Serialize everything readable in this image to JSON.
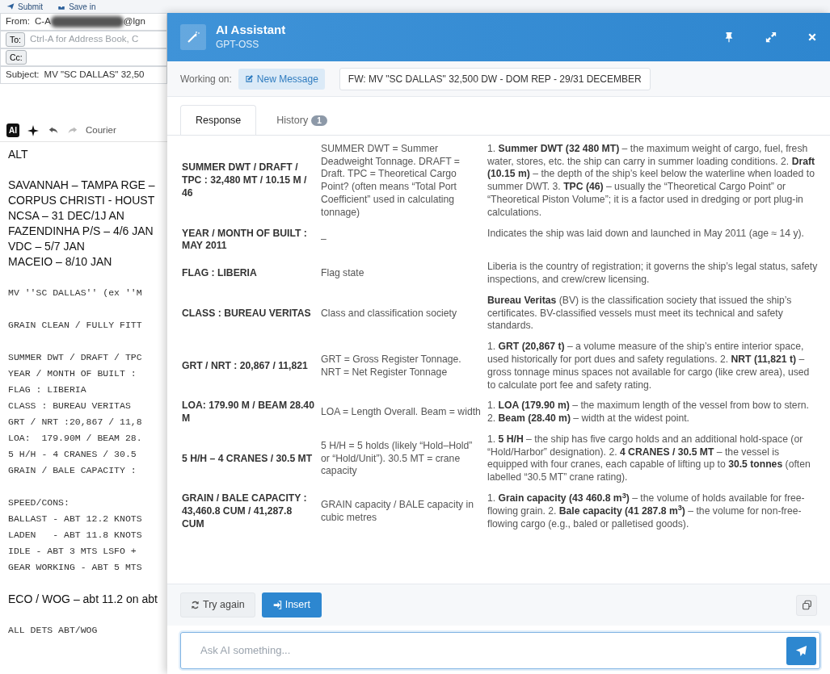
{
  "email": {
    "toolbar": [
      "Submit",
      "Save in"
    ],
    "from_label": "From:",
    "from_start": "C-A",
    "from_end": "@lgn",
    "to_label": "To:",
    "to_placeholder": "Ctrl-A for Address Book, C",
    "cc_label": "Cc:",
    "subject_label": "Subject:",
    "subject_value": "MV \"SC DALLAS\" 32,50",
    "editor_toolbar": {
      "ai_badge": "AI",
      "font": "Courier"
    },
    "body_blocks": [
      {
        "kind": "sans",
        "lines": [
          "ALT"
        ]
      },
      {
        "kind": "sans",
        "lines": [
          "SAVANNAH – TAMPA RGE –",
          "CORPUS CHRISTI - HOUST",
          "NCSA – 31 DEC/1J AN",
          "FAZENDINHA P/S – 4/6 JAN",
          "VDC – 5/7 JAN",
          "MACEIO – 8/10 JAN"
        ]
      },
      {
        "kind": "mono",
        "lines": [
          "MV ''SC DALLAS'' (ex ''M"
        ]
      },
      {
        "kind": "mono",
        "lines": [
          "GRAIN CLEAN / FULLY FITT"
        ]
      },
      {
        "kind": "mono",
        "lines": [
          "SUMMER DWT / DRAFT / TPC",
          "YEAR / MONTH OF BUILT :",
          "FLAG : LIBERIA",
          "CLASS : BUREAU VERITAS",
          "GRT / NRT :20,867 / 11,8",
          "LOA:  179.90M / BEAM 28.",
          "5 H/H - 4 CRANES / 30.5",
          "GRAIN / BALE CAPACITY :"
        ]
      },
      {
        "kind": "mono",
        "lines": [
          "SPEED/CONS:",
          "BALLAST - ABT 12.2 KNOTS",
          "LADEN   - ABT 11.8 KNOTS",
          "IDLE - ABT 3 MTS LSFO +",
          "GEAR WORKING - ABT 5 MTS"
        ]
      },
      {
        "kind": "sans",
        "lines": [
          "ECO / WOG – abt 11.2 on abt"
        ]
      },
      {
        "kind": "mono",
        "lines": [
          "ALL DETS ABT/WOG"
        ]
      }
    ]
  },
  "assistant": {
    "title": "AI Assistant",
    "model": "GPT-OSS",
    "working_on_label": "Working on:",
    "new_message": "New Message",
    "context": "FW: MV \"SC DALLAS\" 32,500 DW - DOM REP - 29/31 DECEMBER",
    "tabs": [
      {
        "label": "Response",
        "selected": true
      },
      {
        "label": "History",
        "count": "1",
        "selected": false
      }
    ],
    "rows": [
      {
        "term": "SUMMER DWT / DRAFT / TPC : 32,480 MT / 10.15 M / 46",
        "meaning": "SUMMER DWT = Summer Deadweight Tonnage. DRAFT = Draft. TPC = Theoretical Cargo Point? (often means “Total Port Coefficient” used in calculating tonnage)",
        "explanation": "1. **Summer DWT (32 480 MT)** – the maximum weight of cargo, fuel, fresh water, stores, etc. the ship can carry in summer loading conditions. 2. **Draft (10.15 m)** – the depth of the ship’s keel below the waterline when loaded to summer DWT. 3. **TPC (46)** – usually the “Theoretical Cargo Point” or “Theoretical Piston Volume”; it is a factor used in dredging or port plug-in calculations."
      },
      {
        "term": "YEAR / MONTH OF BUILT : MAY 2011",
        "meaning": "–",
        "explanation": "Indicates the ship was laid down and launched in May 2011 (age ≈ 14 y)."
      },
      {
        "term": "FLAG : LIBERIA",
        "meaning": "Flag state",
        "explanation": "Liberia is the country of registration; it governs the ship’s legal status, safety inspections, and crew/crew licensing."
      },
      {
        "term": "CLASS : BUREAU VERITAS",
        "meaning": "Class and classification society",
        "explanation": "**Bureau Veritas** (BV) is the classification society that issued the ship’s certificates. BV-classified vessels must meet its technical and safety standards."
      },
      {
        "term": "GRT / NRT : 20,867 / 11,821",
        "meaning": "GRT = Gross Register Tonnage. NRT = Net Register Tonnage",
        "explanation": "1. **GRT (20,867 t)** – a volume measure of the ship’s entire interior space, used historically for port dues and safety regulations. 2. **NRT (11,821 t)** – gross tonnage minus spaces not available for cargo (like crew area), used to calculate port fee and safety rating."
      },
      {
        "term": "LOA: 179.90 M / BEAM 28.40 M",
        "meaning": "LOA = Length Overall. Beam = width",
        "explanation": "1. **LOA (179.90 m)** – the maximum length of the vessel from bow to stern. 2. **Beam (28.40 m)** – width at the widest point."
      },
      {
        "term": "5 H/H – 4 CRANES / 30.5 MT",
        "meaning": "5 H/H = 5 holds (likely “Hold–Hold” or “Hold/Unit”). 30.5 MT = crane capacity",
        "explanation": "1. **5 H/H** – the ship has five cargo holds and an additional hold-space (or “Hold/Harbor” designation). 2. **4 CRANES / 30.5 MT** – the vessel is equipped with four cranes, each capable of lifting up to **30.5 tonnes** (often labelled “30.5 MT” crane rating)."
      },
      {
        "term": "GRAIN / BALE CAPACITY : 43,460.8 CUM / 41,287.8 CUM",
        "meaning": "GRAIN capacity / BALE capacity in cubic metres",
        "explanation": "1. **Grain capacity (43 460.8 m$^{3}$)** – the volume of holds available for free-flowing grain. 2. **Bale capacity (41 287.8 m$^{3}$)** – the volume for non-free-flowing cargo (e.g., baled or palletised goods)."
      }
    ],
    "try_again": "Try again",
    "insert": "Insert",
    "ask_placeholder": "Ask AI something..."
  }
}
